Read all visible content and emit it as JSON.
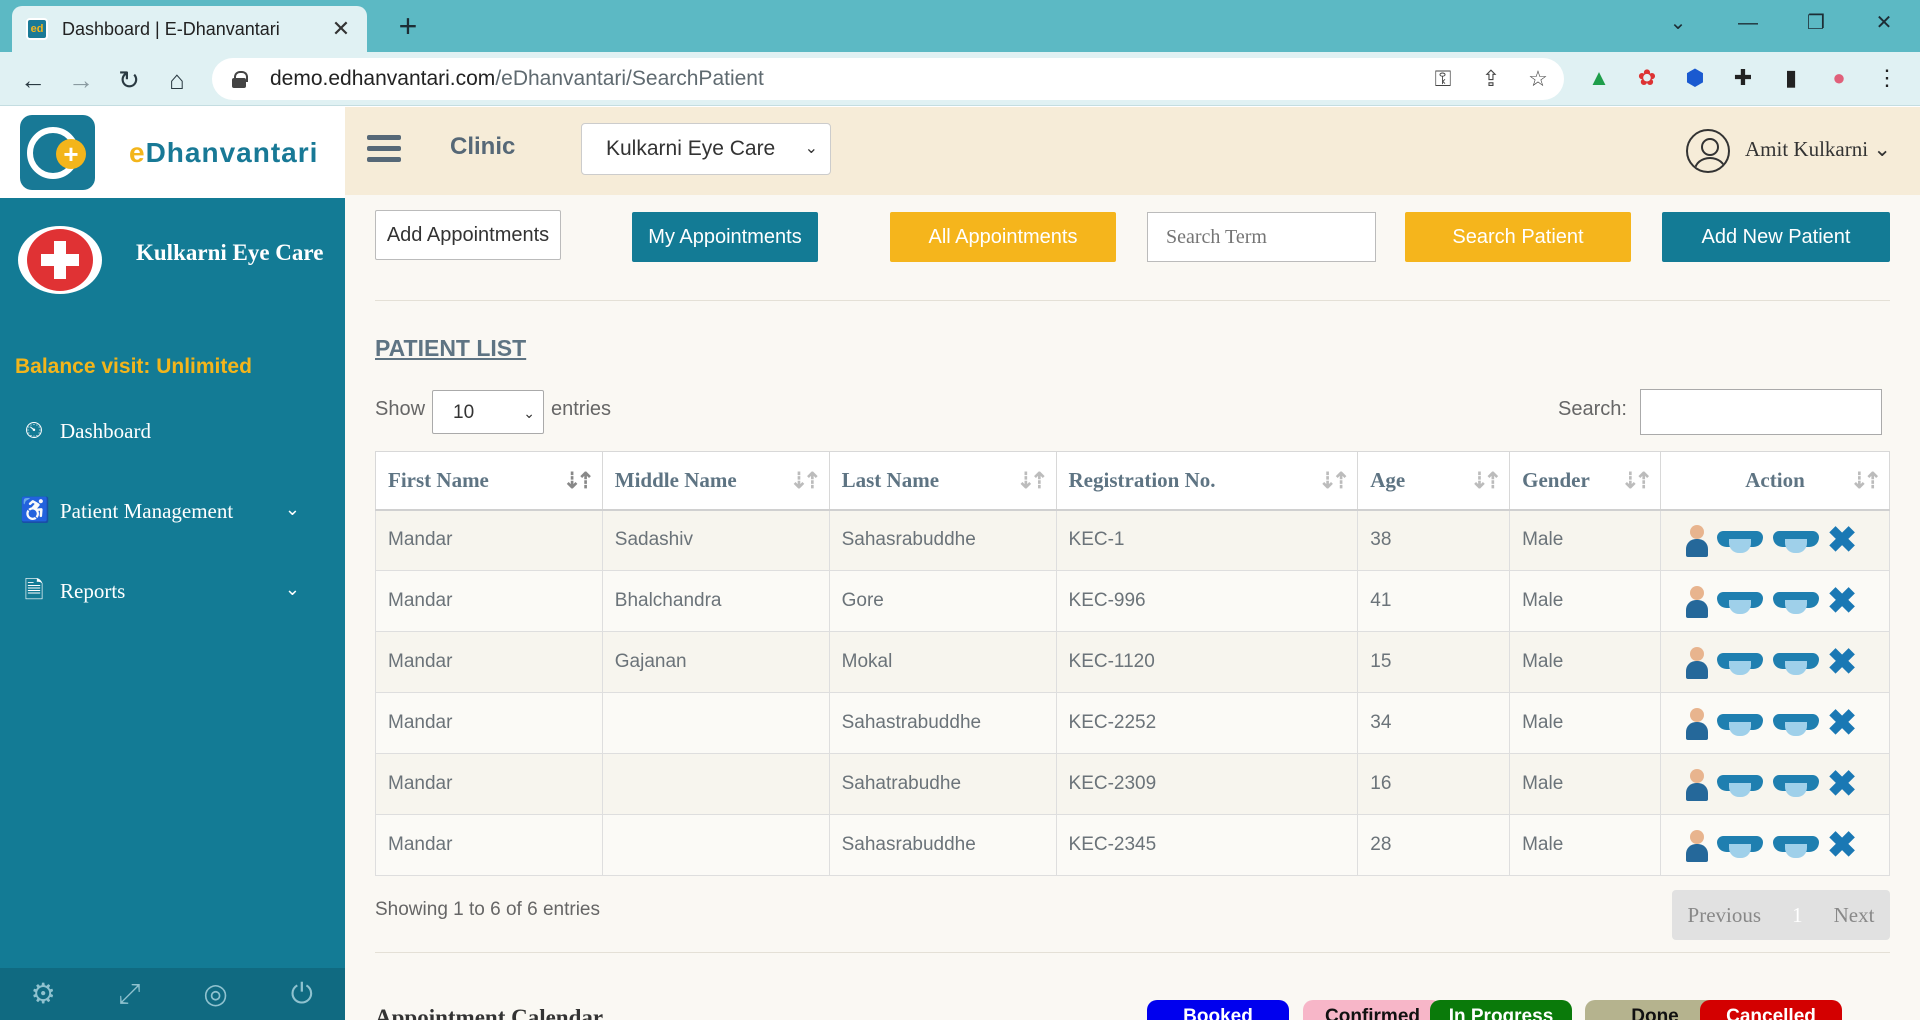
{
  "browser": {
    "tab_title": "Dashboard | E-Dhanvantari",
    "tab_favicon": "ed",
    "close_glyph": "✕",
    "new_tab_glyph": "+",
    "url_host": "demo.edhanvantari.com",
    "url_path": "/eDhanvantari/SearchPatient",
    "icons": {
      "minimize": "—",
      "restore": "❐",
      "close": "✕",
      "chevron": "⌄",
      "back": "←",
      "forward": "→",
      "reload": "↻",
      "home": "⌂",
      "key": "⚿",
      "share": "⇪",
      "star": "☆",
      "drive": "▲",
      "color": "✿",
      "ext": "⬢",
      "puzzle": "✚",
      "panel": "▮",
      "profile": "●",
      "menu": "⋮"
    }
  },
  "brand": {
    "first_letter": "e",
    "rest": "Dhanvantari",
    "logo_plus": "+"
  },
  "sidebar": {
    "clinic_name": "Kulkarni Eye Care",
    "balance": "Balance visit: Unlimited",
    "items": [
      {
        "label": "Dashboard",
        "icon": "⏲"
      },
      {
        "label": "Patient Management",
        "icon": "♿",
        "chevron": "⌄"
      },
      {
        "label": "Reports",
        "icon": "🗎",
        "chevron": "⌄"
      }
    ],
    "footer_icons": [
      "⚙",
      "⤢",
      "◎",
      "⏻"
    ]
  },
  "topbar": {
    "clinic_label": "Clinic",
    "clinic_selected": "Kulkarni Eye Care",
    "select_caret": "⌄",
    "user_name": "Amit Kulkarni",
    "user_caret": "⌄"
  },
  "toolbar": {
    "add_appointments": "Add Appointments",
    "my_appointments": "My Appointments",
    "all_appointments": "All Appointments",
    "search_placeholder": "Search Term",
    "search_patient": "Search Patient",
    "add_new_patient": "Add New Patient"
  },
  "patient_list": {
    "title": "PATIENT LIST",
    "show_label": "Show",
    "show_value": "10",
    "show_caret": "⌄",
    "entries_label": "entries",
    "search_label": "Search:",
    "sort_active": "⇣⇡",
    "sort_idle": "⇣⇡",
    "columns": [
      "First Name",
      "Middle Name",
      "Last Name",
      "Registration No.",
      "Age",
      "Gender",
      "Action"
    ],
    "rows": [
      {
        "first": "Mandar",
        "middle": "Sadashiv",
        "last": "Sahasrabuddhe",
        "reg": "KEC-1",
        "age": "38",
        "gender": "Male"
      },
      {
        "first": "Mandar",
        "middle": "Bhalchandra",
        "last": "Gore",
        "reg": "KEC-996",
        "age": "41",
        "gender": "Male"
      },
      {
        "first": "Mandar",
        "middle": "Gajanan",
        "last": "Mokal",
        "reg": "KEC-1120",
        "age": "15",
        "gender": "Male"
      },
      {
        "first": "Mandar",
        "middle": "",
        "last": "Sahastrabuddhe",
        "reg": "KEC-2252",
        "age": "34",
        "gender": "Male"
      },
      {
        "first": "Mandar",
        "middle": "",
        "last": "Sahatrabudhe",
        "reg": "KEC-2309",
        "age": "16",
        "gender": "Male"
      },
      {
        "first": "Mandar",
        "middle": "",
        "last": "Sahasrabuddhe",
        "reg": "KEC-2345",
        "age": "28",
        "gender": "Male"
      }
    ],
    "delete_glyph": "✖",
    "showing": "Showing 1 to 6 of 6 entries",
    "pager": {
      "previous": "Previous",
      "current": "1",
      "next": "Next"
    }
  },
  "calendar": {
    "title": "Appointment Calendar",
    "statuses": [
      {
        "label": "Booked",
        "bg": "#0000ee",
        "fg": "#ffffff"
      },
      {
        "label": "Confirmed",
        "bg": "#f7b6c8",
        "fg": "#111111"
      },
      {
        "label": "In Progress",
        "bg": "#0a7a0a",
        "fg": "#ffffff"
      },
      {
        "label": "Done",
        "bg": "#b5b38e",
        "fg": "#111111"
      },
      {
        "label": "Cancelled",
        "bg": "#d30000",
        "fg": "#ffffff"
      }
    ]
  }
}
